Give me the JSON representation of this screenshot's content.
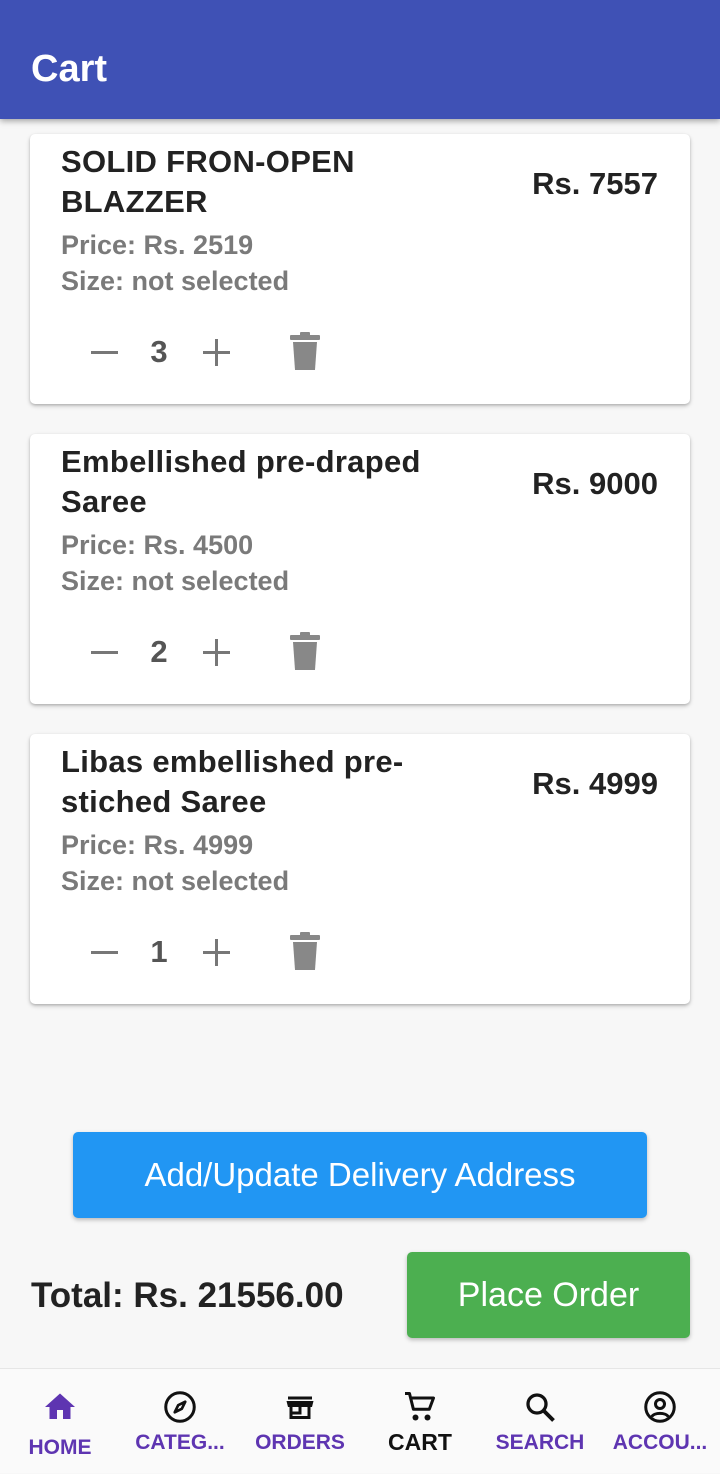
{
  "app_bar": {
    "title": "Cart"
  },
  "cart_items": [
    {
      "name": "SOLID FRON-OPEN BLAZZER",
      "subtotal": "Rs. 7557",
      "price": "Price: Rs. 2519",
      "size": "Size: not selected",
      "quantity": "3"
    },
    {
      "name": "Embellished pre-draped Saree",
      "subtotal": "Rs. 9000",
      "price": "Price: Rs. 4500",
      "size": "Size: not selected",
      "quantity": "2"
    },
    {
      "name": "Libas embellished pre-stiched Saree",
      "subtotal": "Rs. 4999",
      "price": "Price: Rs. 4999",
      "size": "Size: not selected",
      "quantity": "1"
    }
  ],
  "actions": {
    "address_label": "Add/Update Delivery Address",
    "total": "Total: Rs. 21556.00",
    "place_order_label": "Place Order"
  },
  "bottom_nav": {
    "items": [
      {
        "label": "HOME",
        "icon": "home-icon"
      },
      {
        "label": "CATEG...",
        "icon": "compass-icon"
      },
      {
        "label": "ORDERS",
        "icon": "store-icon"
      },
      {
        "label": "CART",
        "icon": "cart-icon"
      },
      {
        "label": "SEARCH",
        "icon": "search-icon"
      },
      {
        "label": "ACCOU...",
        "icon": "account-circle-icon"
      }
    ],
    "selected": "CART"
  },
  "colors": {
    "app_bar": "#3f51b5",
    "address_button": "#2196f3",
    "order_button": "#4caf50",
    "nav_label": "#5e35b1",
    "secondary_text": "#7a7a7a"
  }
}
